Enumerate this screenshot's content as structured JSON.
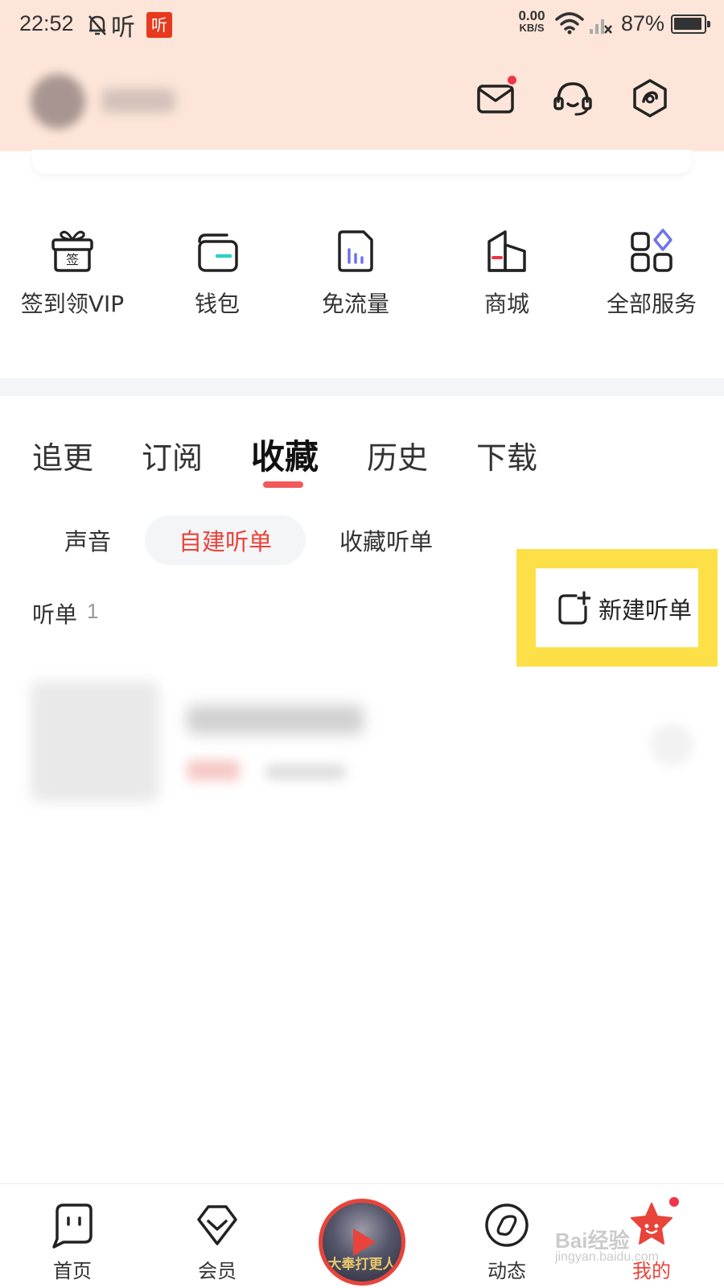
{
  "status_bar": {
    "time": "22:52",
    "app_indicator_text": "听",
    "app_badge_text": "听",
    "net_speed_value": "0.00",
    "net_speed_unit": "KB/S",
    "battery_text": "87%"
  },
  "header": {
    "icons": [
      "mail-icon",
      "headset-icon",
      "settings-icon"
    ],
    "mail_has_badge": true
  },
  "services": [
    {
      "label": "签到领VIP",
      "icon": "gift-sign-icon"
    },
    {
      "label": "钱包",
      "icon": "wallet-icon"
    },
    {
      "label": "免流量",
      "icon": "data-free-icon"
    },
    {
      "label": "商城",
      "icon": "mall-icon"
    },
    {
      "label": "全部服务",
      "icon": "all-services-icon"
    }
  ],
  "main_tabs": [
    {
      "label": "追更",
      "active": false
    },
    {
      "label": "订阅",
      "active": false
    },
    {
      "label": "收藏",
      "active": true
    },
    {
      "label": "历史",
      "active": false
    },
    {
      "label": "下载",
      "active": false
    }
  ],
  "sub_tabs": [
    {
      "label": "声音",
      "active": false
    },
    {
      "label": "自建听单",
      "active": true
    },
    {
      "label": "收藏听单",
      "active": false
    }
  ],
  "playlist_section": {
    "title": "听单",
    "count": "1",
    "new_button_label": "新建听单"
  },
  "bottom_nav": [
    {
      "label": "首页",
      "icon": "home-icon",
      "active": false
    },
    {
      "label": "会员",
      "icon": "vip-icon",
      "active": false
    },
    {
      "label": "",
      "icon": "play-disc-icon",
      "active": false
    },
    {
      "label": "动态",
      "icon": "feed-compass-icon",
      "active": false
    },
    {
      "label": "我的",
      "icon": "profile-star-icon",
      "active": true
    }
  ],
  "now_playing_cover_text": "大奉打更人",
  "watermark": {
    "main": "Bai经验",
    "sub": "jingyan.baidu.com"
  },
  "colors": {
    "accent": "#e8443a",
    "header_bg": "#fde6d9",
    "highlight": "#fde048",
    "badge": "#f0344a"
  }
}
